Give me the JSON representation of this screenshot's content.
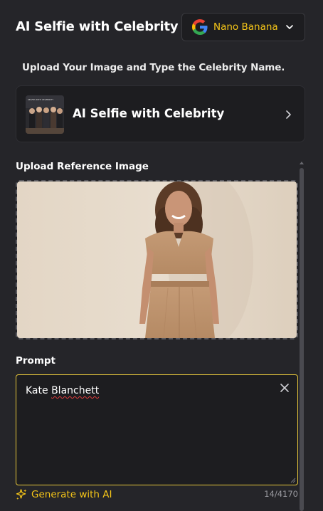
{
  "header": {
    "title": "AI Selfie with Celebrity",
    "model": {
      "label": "Nano Banana",
      "icon": "google-g-icon"
    }
  },
  "subtitle": "Upload Your Image and Type the Celebrity Name.",
  "template_card": {
    "title": "AI Selfie with Celebrity",
    "thumbnail_caption": "SELFIE WITH CELEBRITY"
  },
  "upload": {
    "label": "Upload Reference Image"
  },
  "prompt": {
    "label": "Prompt",
    "value_first": "Kate",
    "value_second": "Blanchett",
    "char_count": "14/4170"
  },
  "generate": {
    "label": "Generate with AI",
    "icon": "sparkle-icon"
  },
  "colors": {
    "background": "#252529",
    "card": "#1d1d20",
    "accent": "#f5c518",
    "focus_border": "#e5c53b"
  }
}
